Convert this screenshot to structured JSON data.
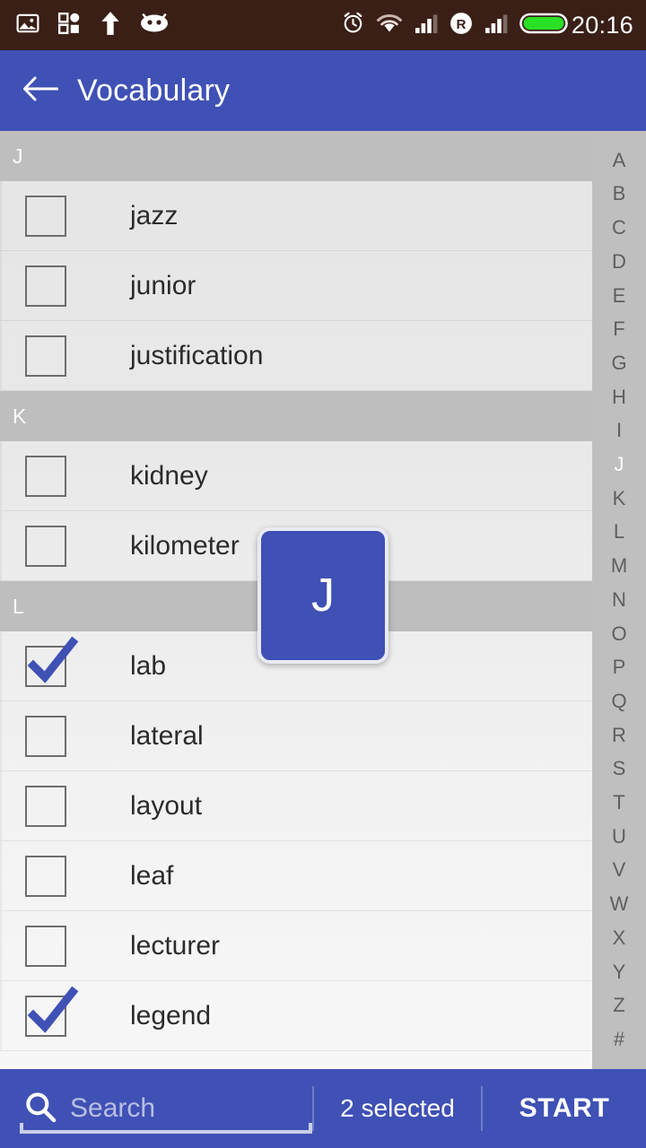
{
  "status_bar": {
    "background": "#3a1f17",
    "clock": "20:16",
    "left_icons": [
      "image-icon",
      "apps-grid-icon",
      "upload-arrow-icon",
      "android-bug-icon"
    ],
    "right_icons": [
      "alarm-icon",
      "wifi-icon",
      "signal-icon",
      "roaming-icon",
      "signal-2-icon",
      "battery-icon"
    ]
  },
  "app_bar": {
    "title": "Vocabulary",
    "back_icon": "arrow-left-icon",
    "background": "#3f51b5"
  },
  "list": {
    "sections": [
      {
        "letter": "J",
        "items": [
          {
            "word": "jazz",
            "checked": false
          },
          {
            "word": "junior",
            "checked": false
          },
          {
            "word": "justification",
            "checked": false
          }
        ]
      },
      {
        "letter": "K",
        "items": [
          {
            "word": "kidney",
            "checked": false
          },
          {
            "word": "kilometer",
            "checked": false
          }
        ]
      },
      {
        "letter": "L",
        "items": [
          {
            "word": "lab",
            "checked": true
          },
          {
            "word": "lateral",
            "checked": false
          },
          {
            "word": "layout",
            "checked": false
          },
          {
            "word": "leaf",
            "checked": false
          },
          {
            "word": "lecturer",
            "checked": false
          },
          {
            "word": "legend",
            "checked": true
          }
        ]
      }
    ]
  },
  "index_strip": {
    "letters": [
      "A",
      "B",
      "C",
      "D",
      "E",
      "F",
      "G",
      "H",
      "I",
      "J",
      "K",
      "L",
      "M",
      "N",
      "O",
      "P",
      "Q",
      "R",
      "S",
      "T",
      "U",
      "V",
      "W",
      "X",
      "Y",
      "Z",
      "#"
    ],
    "active": "J",
    "background": "#bfbfbf"
  },
  "index_overlay": {
    "letter": "J",
    "background": "#3f51b5"
  },
  "bottom_bar": {
    "search_placeholder": "Search",
    "search_value": "",
    "search_icon": "search-icon",
    "selected_count_label": "2 selected",
    "start_label": "START",
    "background": "#3f51b5"
  }
}
